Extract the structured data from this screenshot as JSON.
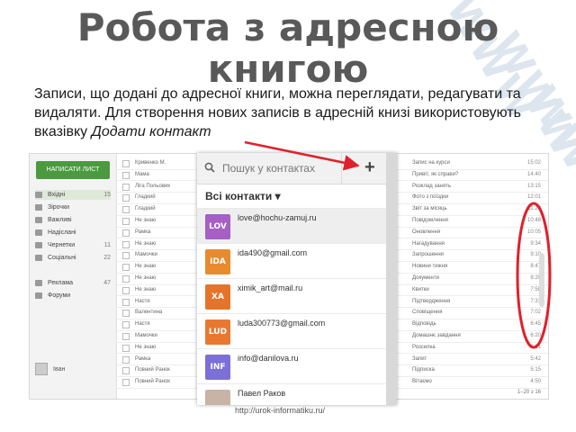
{
  "slide": {
    "title": "Робота з адресною книгою",
    "description_plain": "Записи, що додані до адресної книги, можна переглядати, редагувати та видаляти. Для створення нових записів в адресній книзі використовують вказівку ",
    "description_action": "Додати контакт",
    "footer_url": "http://urok-informatiku.ru/",
    "watermark_text": "WWW",
    "accent_colors": {
      "arrow": "#e0202a",
      "ellipse": "#e0202a",
      "compose": "#4c9a3f"
    }
  },
  "mail_sidebar": {
    "compose_label": "НАПИСАТИ ЛИСТ",
    "items": [
      {
        "label": "Вхідні",
        "count": "15",
        "icon": "inbox-icon"
      },
      {
        "label": "Зірочки",
        "count": "",
        "icon": "star-icon"
      },
      {
        "label": "Важливі",
        "count": "",
        "icon": "important-icon"
      },
      {
        "label": "Надіслані",
        "count": "",
        "icon": "sent-icon"
      },
      {
        "label": "Чернетки",
        "count": "11",
        "icon": "draft-icon"
      },
      {
        "label": "Соціальні",
        "count": "22",
        "icon": "social-icon"
      },
      {
        "label": "Реклама",
        "count": "47",
        "icon": "promo-icon"
      },
      {
        "label": "Форуми",
        "count": "",
        "icon": "forum-icon"
      }
    ],
    "account_label": "Іван"
  },
  "mail_rows": [
    {
      "sender": "Кривенко М.",
      "subject": "Запис на курси",
      "date": "15:02"
    },
    {
      "sender": "Мама",
      "subject": "Привіт, як справи?",
      "date": "14:40"
    },
    {
      "sender": "Ліга Польовик",
      "subject": "Розклад занять",
      "date": "13:15"
    },
    {
      "sender": "Гладкий",
      "subject": "Фото з поїздки",
      "date": "12:01"
    },
    {
      "sender": "Гладкий",
      "subject": "Звіт за місяць",
      "date": "11:22"
    },
    {
      "sender": "Не знаю",
      "subject": "Повідомлення",
      "date": "10:48"
    },
    {
      "sender": "Рамка",
      "subject": "Оновлення",
      "date": "10:05"
    },
    {
      "sender": "Не знаю",
      "subject": "Нагадування",
      "date": "9:34"
    },
    {
      "sender": "Мамочки",
      "subject": "Запрошення",
      "date": "9:10"
    },
    {
      "sender": "Не знаю",
      "subject": "Новини тижня",
      "date": "8:47"
    },
    {
      "sender": "Не знаю",
      "subject": "Документи",
      "date": "8:20"
    },
    {
      "sender": "Не знаю",
      "subject": "Квитки",
      "date": "7:58"
    },
    {
      "sender": "Настя",
      "subject": "Підтвердження",
      "date": "7:31"
    },
    {
      "sender": "Валентина",
      "subject": "Сповіщення",
      "date": "7:02"
    },
    {
      "sender": "Настя",
      "subject": "Відповідь",
      "date": "6:45"
    },
    {
      "sender": "Мамочки",
      "subject": "Домашнє завдання",
      "date": "6:20"
    },
    {
      "sender": "Не знаю",
      "subject": "Розсилка",
      "date": "6:01"
    },
    {
      "sender": "Рамка",
      "subject": "Запит",
      "date": "5:42"
    },
    {
      "sender": "Повний Ранок",
      "subject": "Підписка",
      "date": "5:15"
    },
    {
      "sender": "Повний Ранок",
      "subject": "Вітаємо",
      "date": "4:50"
    }
  ],
  "mail_pager": "1–20 з 16",
  "contacts_panel": {
    "search_placeholder": "Пошук у контактах",
    "add_label": "+",
    "all_contacts_label": "Всі контакти ▾",
    "contacts": [
      {
        "avatar": "LOV",
        "email": "love@hochu-zamuj.ru",
        "color": "#a65fc4"
      },
      {
        "avatar": "IDA",
        "email": "ida490@gmail.com",
        "color": "#e88a2e"
      },
      {
        "avatar": "XA",
        "email": "ximik_art@mail.ru",
        "color": "#e5742b"
      },
      {
        "avatar": "LUD",
        "email": "luda300773@gmail.com",
        "color": "#e8782f"
      },
      {
        "avatar": "INF",
        "email": "info@danilova.ru",
        "color": "#7c6fd8"
      },
      {
        "avatar": "",
        "email": "Павел Раков",
        "color": "#c7b4a6"
      }
    ]
  }
}
